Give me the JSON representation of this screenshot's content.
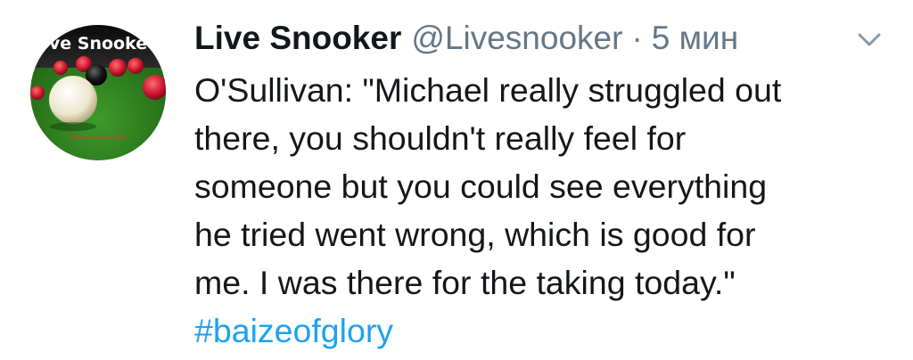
{
  "avatar": {
    "title_text": "ve Snooke",
    "footer_text": "www.livesnooker.com",
    "colors": {
      "felt": "#2e7d1f",
      "ball_white": "#f2efe2",
      "ball_red": "#c8102e",
      "ball_black": "#111111"
    }
  },
  "header": {
    "name": "Live Snooker",
    "handle": "@Livesnooker",
    "separator": "·",
    "time": "5 мин",
    "menu_icon": "chevron-down-icon"
  },
  "tweet": {
    "lines": [
      "O'Sullivan: \"Michael really struggled out",
      "there, you shouldn't really feel for",
      "someone but you could see everything",
      "he tried went wrong, which is good for",
      "me. I was there for the taking today.\""
    ],
    "hashtag": "#baizeofglory"
  },
  "colors": {
    "text": "#14171a",
    "secondary": "#657786",
    "link": "#1da1f2"
  }
}
